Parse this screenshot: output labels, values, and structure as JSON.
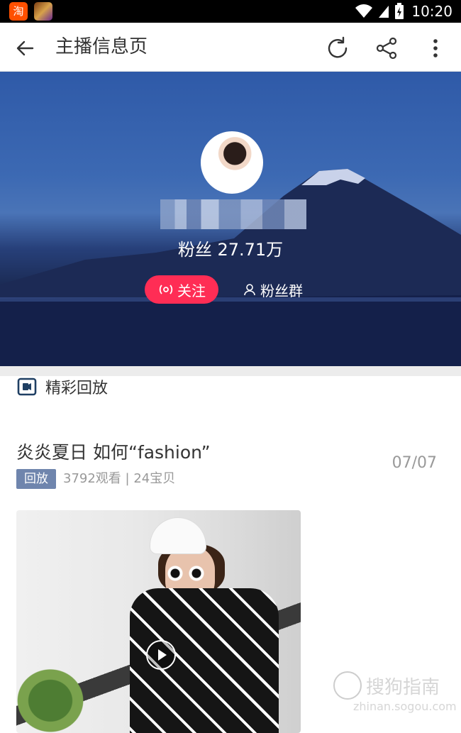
{
  "status_bar": {
    "time": "10:20",
    "taobao_glyph": "淘",
    "icons": [
      "taobao-app-icon",
      "game-app-icon",
      "wifi-icon",
      "signal-icon",
      "battery-icon"
    ]
  },
  "toolbar": {
    "title": "主播信息页",
    "icons": [
      "back-arrow-icon",
      "refresh-icon",
      "share-icon",
      "more-vert-icon"
    ]
  },
  "profile": {
    "fans_text": "粉丝 27.71万",
    "follow_label": "关注",
    "fan_group_label": "粉丝群"
  },
  "section": {
    "title": "精彩回放"
  },
  "video": {
    "title": "炎炎夏日 如何“fashion”",
    "badge": "回放",
    "meta": "3792观看 | 24宝贝",
    "date": "07/07"
  },
  "watermark": {
    "name": "搜狗指南",
    "url": "zhinan.sogou.com"
  },
  "colors": {
    "accent": "#ff2d55",
    "badge": "#6f85ad",
    "text": "#333333",
    "muted": "#999999"
  }
}
